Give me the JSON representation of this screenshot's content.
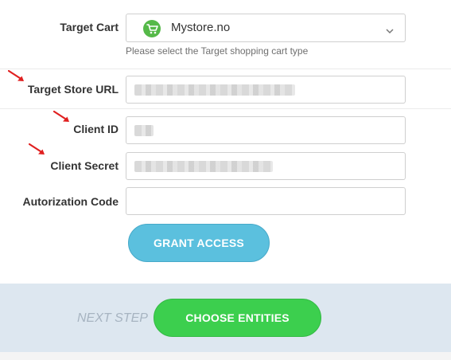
{
  "form": {
    "target_cart": {
      "label": "Target Cart",
      "selected": "Mystore.no",
      "hint": "Please select the Target shopping cart type"
    },
    "target_store_url": {
      "label": "Target Store URL",
      "value_state": "blurred"
    },
    "client_id": {
      "label": "Client ID",
      "value_state": "blurred"
    },
    "client_secret": {
      "label": "Client Secret",
      "value_state": "blurred"
    },
    "authorization_code": {
      "label": "Autorization Code",
      "value": ""
    },
    "grant_access_label": "GRANT ACCESS"
  },
  "footer": {
    "next_step_label": "NEXT STEP",
    "choose_entities_label": "CHOOSE ENTITIES"
  },
  "colors": {
    "grant_button": "#5bc0de",
    "choose_button": "#3ccf4e",
    "footer_bg": "#dde7f0",
    "arrow": "#e02020",
    "cart_logo": "#55b948"
  },
  "icons": {
    "cart_logo": "shopping-cart-icon",
    "select_chevron": "chevron-down-icon",
    "annotation_arrow": "red-arrow-icon"
  }
}
